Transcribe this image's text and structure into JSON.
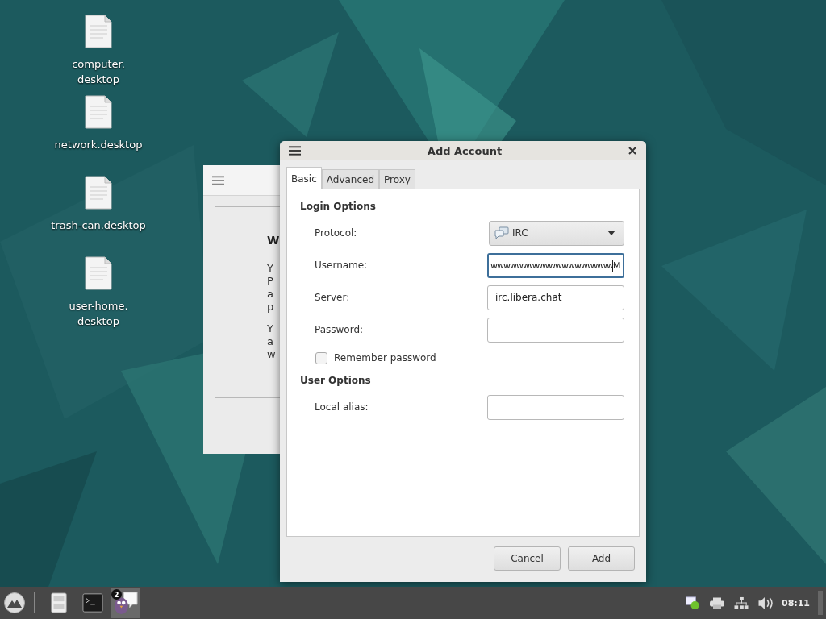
{
  "desktop_icons": [
    {
      "label": "computer.\ndesktop"
    },
    {
      "label": "network.desktop"
    },
    {
      "label": "trash-can.desktop"
    },
    {
      "label": "user-home.\ndesktop"
    }
  ],
  "background_window": {
    "heading": "W",
    "paragraphs": [
      [
        "Y",
        "P",
        "a",
        "p"
      ],
      [
        "Y",
        "a",
        "w"
      ]
    ]
  },
  "dialog": {
    "title": "Add Account",
    "tabs": [
      {
        "label": "Basic",
        "selected": true
      },
      {
        "label": "Advanced",
        "selected": false
      },
      {
        "label": "Proxy",
        "selected": false
      }
    ],
    "sections": [
      {
        "title": "Login Options",
        "rows": [
          {
            "kind": "dropdown",
            "label": "Protocol:",
            "value": "IRC"
          },
          {
            "kind": "field",
            "label": "Username:",
            "value": "wwwwwwwwwwwwwwwwwwwM",
            "focused": true
          },
          {
            "kind": "field",
            "label": "Server:",
            "value": "irc.libera.chat",
            "focused": false
          },
          {
            "kind": "field",
            "label": "Password:",
            "value": "",
            "focused": false
          },
          {
            "kind": "checkbox",
            "label": "Remember password",
            "checked": false
          }
        ]
      },
      {
        "title": "User Options",
        "rows": [
          {
            "kind": "field",
            "label": "Local alias:",
            "value": "",
            "focused": false
          }
        ]
      }
    ],
    "buttons": [
      "Cancel",
      "Add"
    ]
  },
  "taskbar": {
    "badge": "2",
    "clock": "08:11"
  }
}
